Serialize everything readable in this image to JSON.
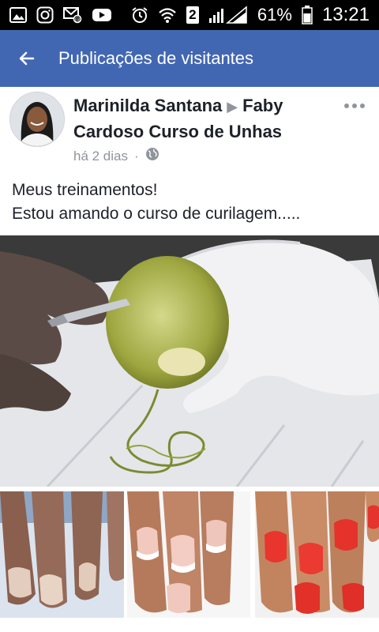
{
  "status_bar": {
    "battery_percent": "61%",
    "time": "13:21",
    "sim_number": "2",
    "icons": [
      "image-icon",
      "instagram-icon",
      "email-icon",
      "youtube-icon",
      "alarm-icon",
      "wifi-icon",
      "signal-icon",
      "battery-icon"
    ]
  },
  "header": {
    "title": "Publicações de visitantes",
    "back_icon": "arrow-left-icon"
  },
  "post": {
    "author": "Marinilda Santana",
    "target": "Faby Cardoso Curso de Unhas",
    "time": "há 2 dias",
    "separator": "·",
    "privacy_icon": "globe-icon",
    "text_line1": "Meus treinamentos!",
    "text_line2": "Estou amando o curso de curilagem.....",
    "photos": [
      {
        "name": "lime-peeling-photo"
      },
      {
        "name": "nails-before-photo"
      },
      {
        "name": "nails-white-tips-photo"
      },
      {
        "name": "nails-red-polish-photo"
      }
    ]
  },
  "colors": {
    "header_bg": "#4267b2",
    "text": "#1d2129",
    "meta": "#90949c"
  }
}
